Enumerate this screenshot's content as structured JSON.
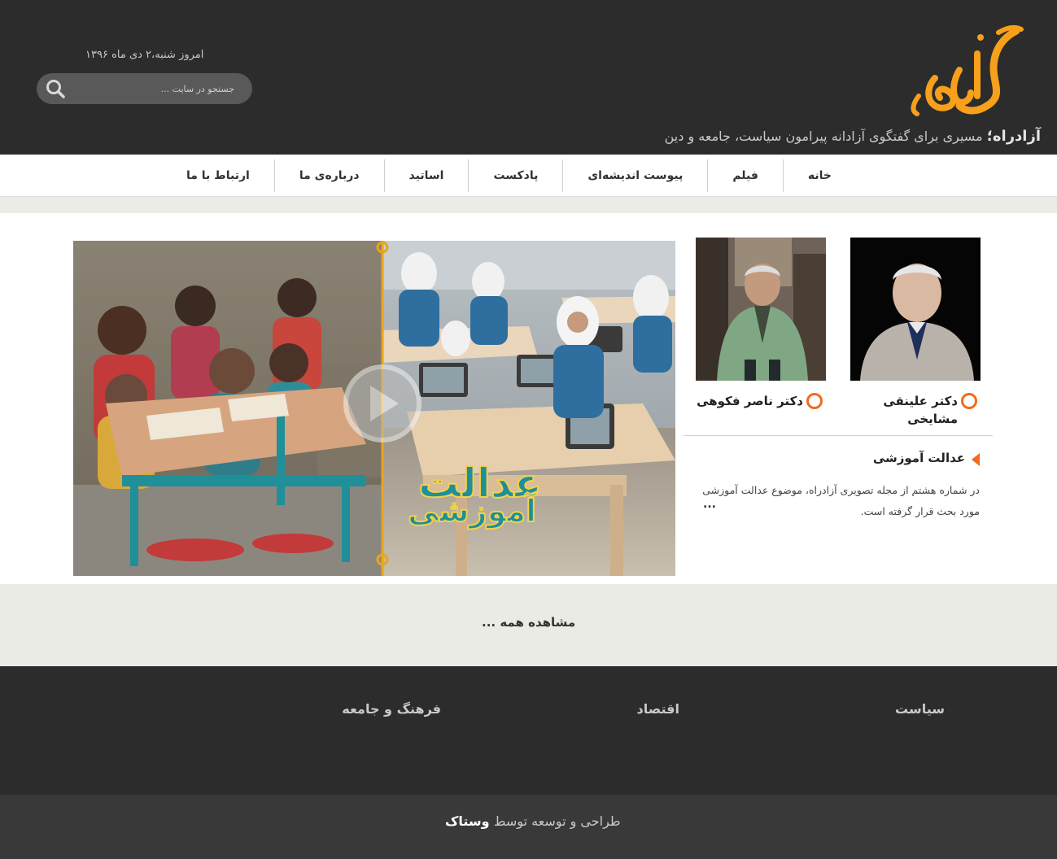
{
  "header": {
    "site_name": "آزادراه؛",
    "tagline": " مسیری برای گفتگوی آزادانه پیرامون سیاست، جامعه و دین",
    "today": "امروز شنبه،۲ دی ماه ۱۳۹۶",
    "search_placeholder": "جستجو در سایت ...",
    "logo_text": "آزادراه",
    "accent_color": "#f7a01b"
  },
  "nav": {
    "items": [
      {
        "label": "خانه"
      },
      {
        "label": "فیلم"
      },
      {
        "label": "پیوست اندیشه‌ای"
      },
      {
        "label": "پادکست"
      },
      {
        "label": "اساتید"
      },
      {
        "label": "درباره‌ی ما"
      },
      {
        "label": "ارتباط با ما"
      }
    ]
  },
  "feature": {
    "overlay_text_line1": "عدالت",
    "overlay_text_line2": "آموزشی",
    "play_icon": "play-icon"
  },
  "people": [
    {
      "name": "دکتر علینقی مشایخی"
    },
    {
      "name": "دکتر ناصر فکوهی"
    }
  ],
  "article": {
    "title": "عدالت آموزشی",
    "text": "در شماره هشتم از مجله تصویری آزادراه، موضوع عدالت آموزشی مورد بحث قرار گرفته است.",
    "more": "..."
  },
  "view_all": "مشاهده همه ...",
  "footer": {
    "categories": [
      "سیاست",
      "اقتصاد",
      "فرهنگ و جامعه"
    ],
    "credit_prefix": "طراحی و توسعه توسط ",
    "credit_brand": "وستاک"
  },
  "colors": {
    "dark": "#2d2c2c",
    "accent_orange": "#f26b1d",
    "light_bg": "#ebebe5"
  }
}
